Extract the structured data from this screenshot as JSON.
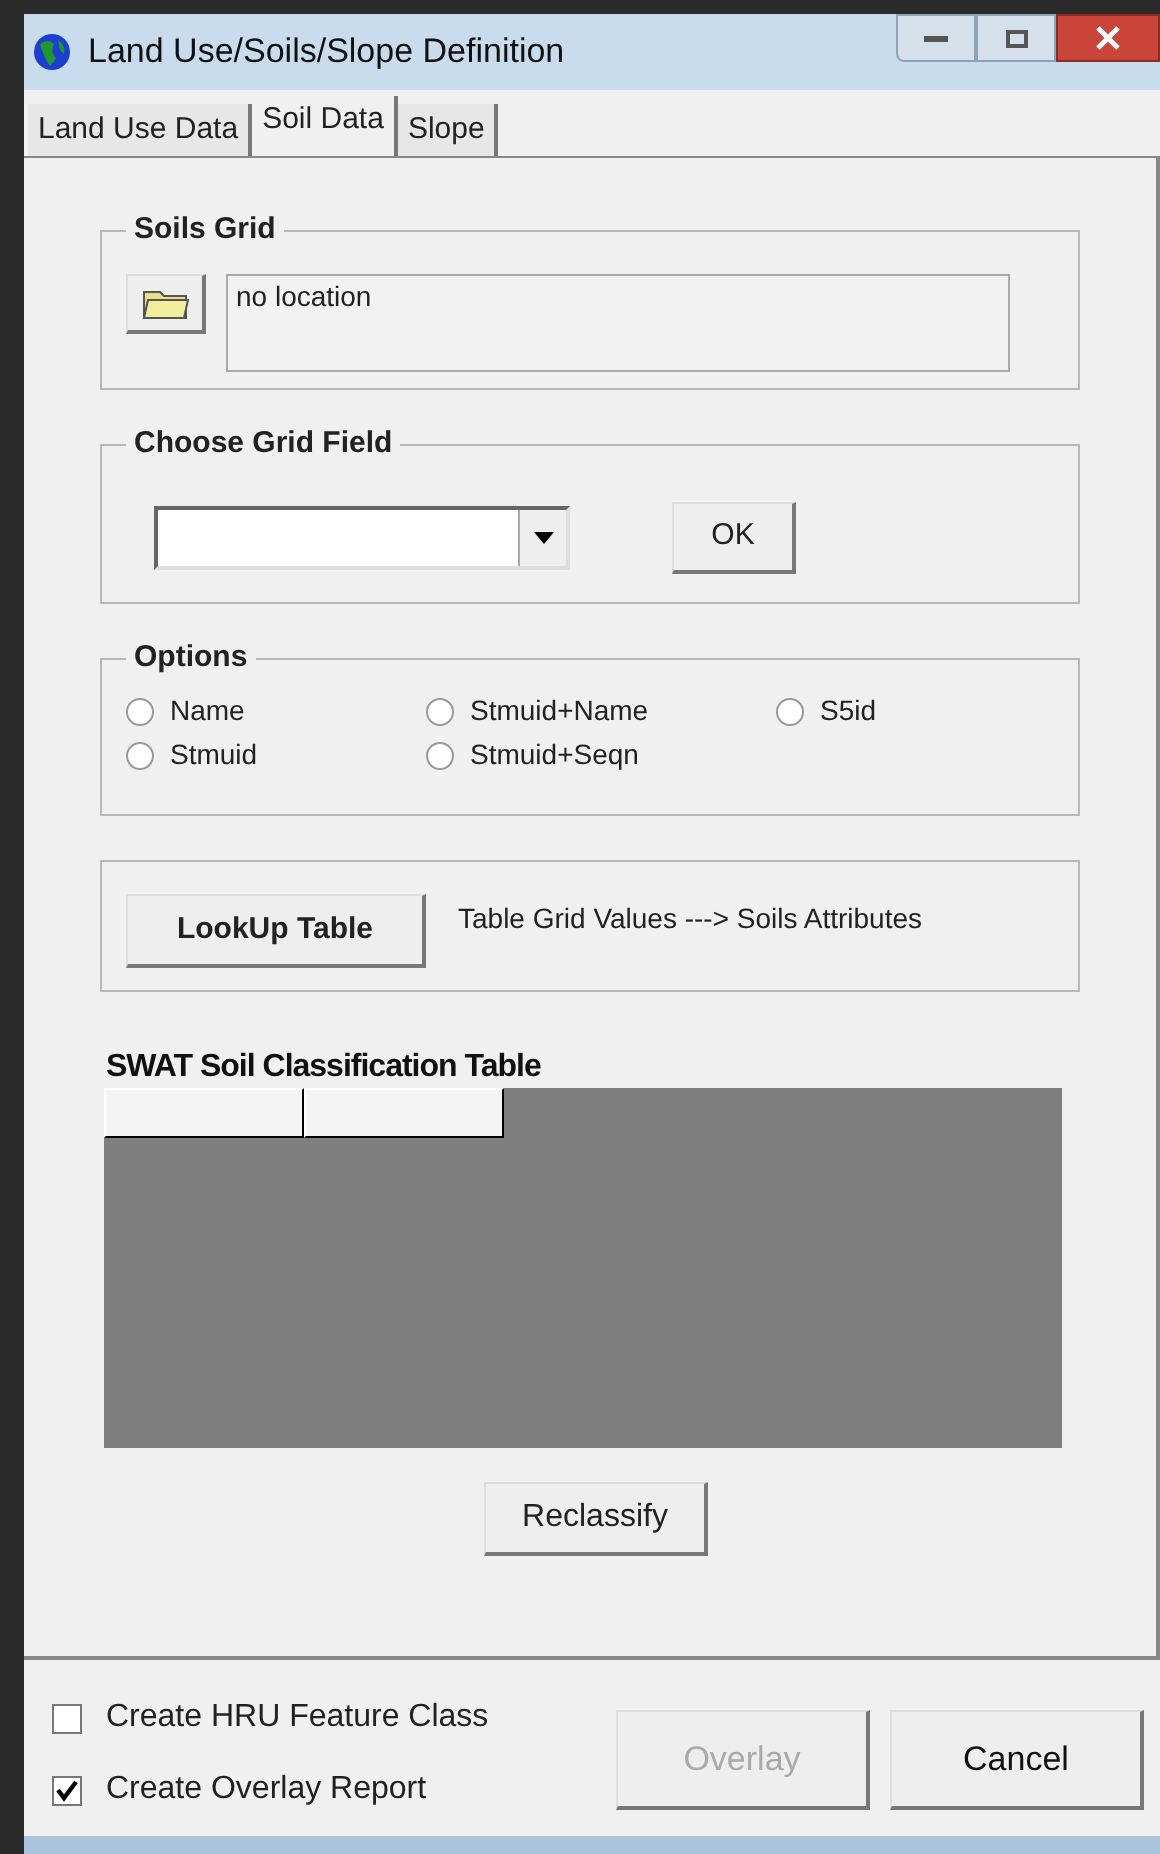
{
  "window": {
    "title": "Land Use/Soils/Slope Definition"
  },
  "tabs": [
    {
      "label": "Land Use Data",
      "selected": false
    },
    {
      "label": "Soil Data",
      "selected": true
    },
    {
      "label": "Slope",
      "selected": false
    }
  ],
  "soils_grid": {
    "title": "Soils Grid",
    "location": "no location"
  },
  "choose_grid_field": {
    "title": "Choose Grid Field",
    "ok_button": "OK"
  },
  "options": {
    "title": "Options",
    "radios": [
      {
        "label": "Name",
        "selected": false
      },
      {
        "label": "Stmuid+Name",
        "selected": false
      },
      {
        "label": "S5id",
        "selected": false
      },
      {
        "label": "Stmuid",
        "selected": false
      },
      {
        "label": "Stmuid+Seqn",
        "selected": false
      }
    ]
  },
  "lookup": {
    "button": "LookUp Table",
    "description": "Table Grid Values ---> Soils Attributes"
  },
  "table": {
    "title": "SWAT Soil Classification Table"
  },
  "reclassify_button": "Reclassify",
  "checkboxes": [
    {
      "label": "Create HRU Feature Class",
      "checked": false
    },
    {
      "label": "Create Overlay Report",
      "checked": true
    }
  ],
  "buttons": [
    {
      "label": "Overlay",
      "disabled": true
    },
    {
      "label": "Cancel",
      "disabled": false
    }
  ]
}
